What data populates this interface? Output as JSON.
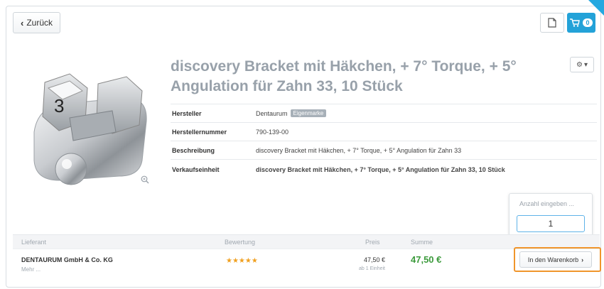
{
  "nav": {
    "back_label": "Zurück"
  },
  "header": {
    "cart_count": "0"
  },
  "product": {
    "title": "discovery Bracket mit Häkchen, + 7° Torque, + 5° Angulation für Zahn 33, 10 Stück",
    "image_number": "3",
    "specs": [
      {
        "label": "Hersteller",
        "value": "Dentaurum",
        "badge": "Eigenmarke"
      },
      {
        "label": "Herstellernummer",
        "value": "790-139-00"
      },
      {
        "label": "Beschreibung",
        "value": "discovery Bracket mit Häkchen, + 7° Torque, + 5° Angulation für Zahn 33"
      },
      {
        "label": "Verkaufseinheit",
        "value": "discovery Bracket mit Häkchen, + 7° Torque, + 5° Angulation für Zahn 33, 10 Stück"
      }
    ]
  },
  "quantity": {
    "placeholder": "Anzahl eingeben ...",
    "value": "1"
  },
  "offers": {
    "columns": [
      "Lieferant",
      "Bewertung",
      "Preis",
      "Summe"
    ],
    "rows": [
      {
        "supplier": "DENTAURUM GmbH & Co. KG",
        "more": "Mehr ...",
        "rating": "★★★★★",
        "rating_value": 5,
        "price": "47,50 €",
        "unit": "ab 1 Einheit",
        "total": "47,50 €",
        "add_to_cart": "In den Warenkorb"
      }
    ]
  },
  "colors": {
    "accent": "#23a2d8",
    "title": "#98a1aa",
    "total": "#3b9a3b",
    "highlight": "#f0952b",
    "stars": "#f0a020"
  },
  "icons": [
    "chevron-left-icon",
    "document-icon",
    "cart-icon",
    "gear-icon",
    "caret-down-icon",
    "zoom-icon",
    "chevron-right-icon"
  ]
}
